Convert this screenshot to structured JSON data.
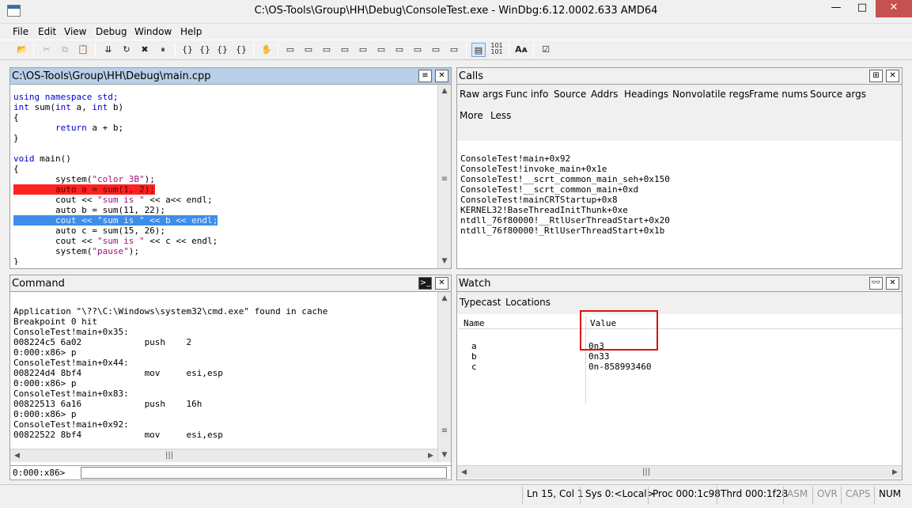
{
  "window": {
    "title": "C:\\OS-Tools\\Group\\HH\\Debug\\ConsoleTest.exe - WinDbg:6.12.0002.633 AMD64",
    "min": "—",
    "max": "□",
    "close": "✕"
  },
  "menu": [
    "File",
    "Edit",
    "View",
    "Debug",
    "Window",
    "Help"
  ],
  "toolbar_icons": [
    "open-icon",
    "cut-icon",
    "copy-icon",
    "paste-icon",
    "go-icon",
    "restart-icon",
    "stop-icon",
    "break-icon",
    "step-into-icon",
    "step-over-icon",
    "step-out-icon",
    "run-to-cursor-icon",
    "source-mode-icon",
    "command-window-icon",
    "watch-window-icon",
    "locals-window-icon",
    "registers-window-icon",
    "memory-window-icon",
    "call-stack-icon",
    "disassembly-window-icon",
    "scratch-pad-icon",
    "source-mode-toggle-icon",
    "hex-mode-icon",
    "font-icon",
    "options-icon"
  ],
  "source": {
    "title": "C:\\OS-Tools\\Group\\HH\\Debug\\main.cpp",
    "lines": [
      "using namespace std;",
      "",
      "int sum(int a, int b)",
      "{",
      "        return a + b;",
      "}",
      "",
      "void main()",
      "{",
      "        system(\"color 3B\");",
      "        auto a = sum(1, 2);",
      "        cout << \"sum is \" << a<< endl;",
      "        auto b = sum(11, 22);",
      "        cout << \"sum is \" << b << endl;",
      "        auto c = sum(15, 26);",
      "        cout << \"sum is \" << c << endl;",
      "        system(\"pause\");",
      "}"
    ]
  },
  "calls": {
    "title": "Calls",
    "options_row1": [
      "Raw args",
      "Func info",
      "Source",
      "Addrs",
      "Headings",
      "Nonvolatile regs",
      "Frame nums",
      "Source args"
    ],
    "options_row2": [
      "More",
      "Less"
    ],
    "frames": [
      "ConsoleTest!main+0x92",
      "ConsoleTest!invoke_main+0x1e",
      "ConsoleTest!__scrt_common_main_seh+0x150",
      "ConsoleTest!__scrt_common_main+0xd",
      "ConsoleTest!mainCRTStartup+0x8",
      "KERNEL32!BaseThreadInitThunk+0xe",
      "ntdll_76f80000!__RtlUserThreadStart+0x20",
      "ntdll_76f80000!_RtlUserThreadStart+0x1b"
    ]
  },
  "command": {
    "title": "Command",
    "lines": [
      "Application \"\\??\\C:\\Windows\\system32\\cmd.exe\" found in cache",
      "Breakpoint 0 hit",
      "ConsoleTest!main+0x35:",
      "008224c5 6a02            push    2",
      "0:000:x86> p",
      "ConsoleTest!main+0x44:",
      "008224d4 8bf4            mov     esi,esp",
      "0:000:x86> p",
      "ConsoleTest!main+0x83:",
      "00822513 6a16            push    16h",
      "0:000:x86> p",
      "ConsoleTest!main+0x92:",
      "00822522 8bf4            mov     esi,esp"
    ],
    "prompt": "0:000:x86>",
    "input_value": ""
  },
  "watch": {
    "title": "Watch",
    "options": [
      "Typecast",
      "Locations"
    ],
    "headers": [
      "Name",
      "Value"
    ],
    "rows": [
      {
        "name": "a",
        "value": "0n3"
      },
      {
        "name": "b",
        "value": "0n33"
      },
      {
        "name": "c",
        "value": "0n-858993460"
      }
    ],
    "highlight_color": "#e01010"
  },
  "status": {
    "position": "Ln 15, Col 1",
    "sys": "Sys 0:<Local>",
    "proc": "Proc 000:1c98",
    "thrd": "Thrd 000:1f28",
    "asm": "ASM",
    "ovr": "OVR",
    "caps": "CAPS",
    "num": "NUM"
  },
  "colors": {
    "breakpoint_line": "#ff2020",
    "current_line": "#3c8ee8",
    "keyword": "#0000cc",
    "string": "#a01080",
    "active_pane_header": "#b8cfe9"
  }
}
